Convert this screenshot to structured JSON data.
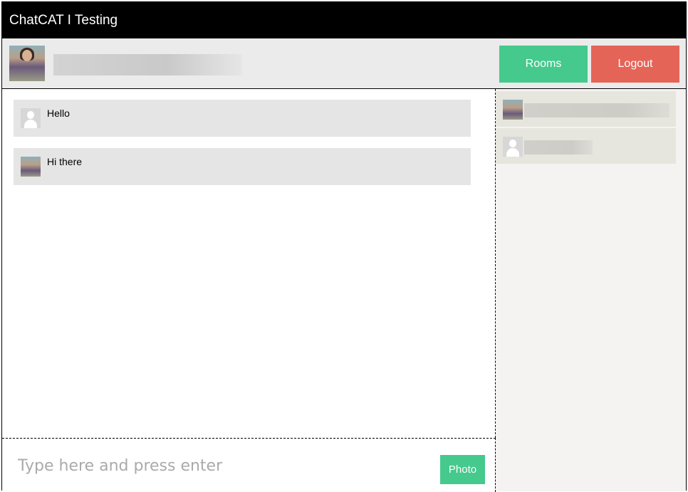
{
  "app": {
    "title": "ChatCAT I Testing"
  },
  "header": {
    "user_name_blurred": "",
    "rooms_label": "Rooms",
    "logout_label": "Logout"
  },
  "messages": [
    {
      "text": "Hello",
      "avatar": "default-avatar-icon"
    },
    {
      "text": "Hi there",
      "avatar": "user-photo"
    }
  ],
  "composer": {
    "placeholder": "Type here and press enter",
    "photo_label": "Photo"
  },
  "users_list": [
    {
      "name_blurred": "",
      "avatar": "user-photo"
    },
    {
      "name_blurred": "",
      "avatar": "default-avatar-icon"
    }
  ],
  "colors": {
    "titlebar": "#000000",
    "rooms_button": "#45c98d",
    "logout_button": "#e56458",
    "photo_button": "#45c98d",
    "message_bg": "#e5e5e5",
    "sidebar_bg": "#f4f3f1"
  }
}
